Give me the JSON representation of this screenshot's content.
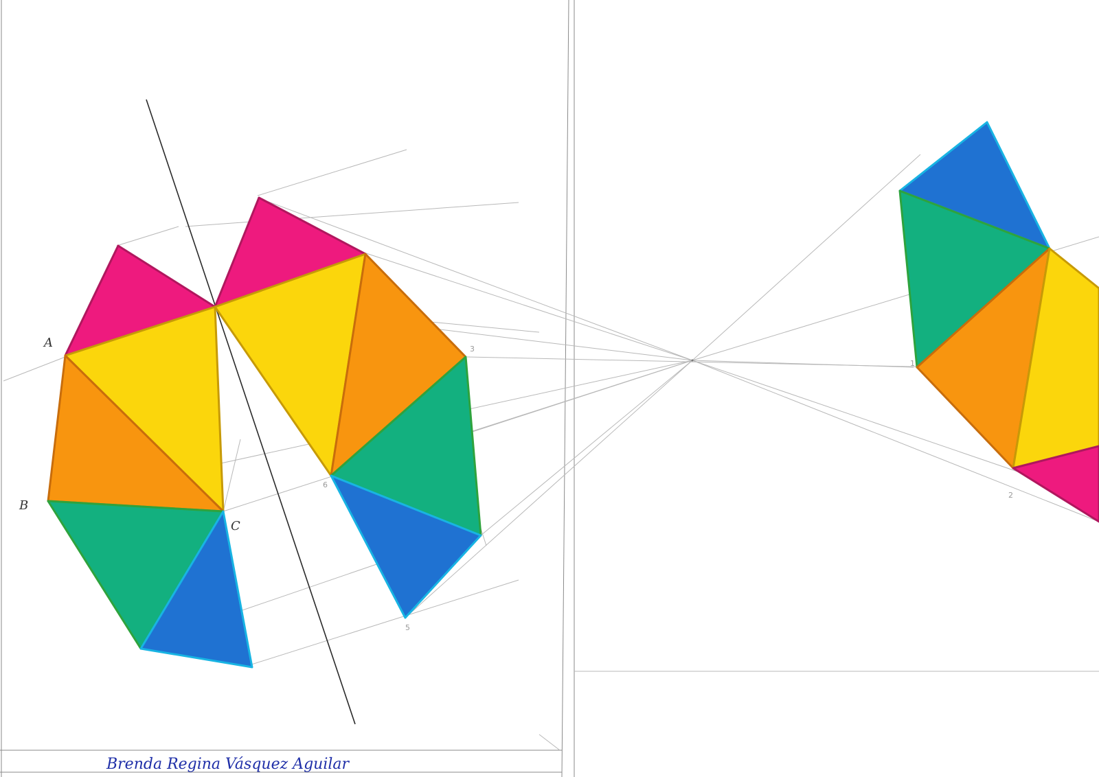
{
  "colors": {
    "magenta": "#ee1a7e",
    "yellow": "#fbd60c",
    "orange": "#f8950f",
    "green": "#13b07f",
    "blue": "#1f72d2",
    "edge_magenta": "#b0175e",
    "edge_yellow": "#c79a07",
    "edge_orange": "#c86d0c",
    "edge_green": "#2ea33d",
    "edge_blue": "#18b4e3",
    "pencil": "#b8b8b8",
    "signature_ink": "#1f2fa8"
  },
  "labels": {
    "A": "A",
    "B": "B",
    "C": "C",
    "n3": "3",
    "n5": "5",
    "n6": "6",
    "n1": "1",
    "n2": "2"
  },
  "signature": "Brenda Regina Vásquez Aguilar"
}
